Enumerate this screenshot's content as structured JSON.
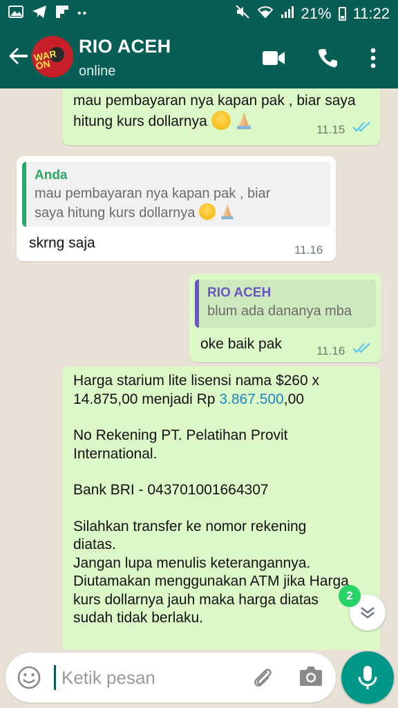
{
  "status_bar": {
    "battery": "21%",
    "time": "11:22"
  },
  "header": {
    "contact_name": "RIO ACEH",
    "status": "online",
    "avatar_text": "WAR ON"
  },
  "messages": [
    {
      "direction": "out",
      "lines": [
        "mau pembayaran nya kapan pak , biar saya",
        "hitung kurs dollarnya"
      ],
      "time": "11.15",
      "read": true
    },
    {
      "direction": "in",
      "quote_name": "Anda",
      "quote_lines": [
        "mau pembayaran nya kapan pak , biar",
        "saya hitung kurs dollarnya"
      ],
      "text": "skrng saja",
      "time": "11.16"
    },
    {
      "direction": "out",
      "quote_name": "RIO ACEH",
      "quote_text": "blum ada dananya mba",
      "text": "oke baik pak",
      "time": "11.16",
      "read": true
    },
    {
      "direction": "out",
      "line1": "Harga starium lite lisensi nama  $260 x",
      "line2_pre": "14.875,00  menjadi Rp ",
      "line2_link": "3.867.500",
      "line2_post": ",00",
      "line3": "No Rekening PT. Pelatihan Provit",
      "line4": "International.",
      "line5": "Bank BRI -  043701001664307",
      "line6": "Silahkan transfer ke nomor rekening",
      "line7": "diatas.",
      "line8": "Jangan lupa menulis keterangannya.",
      "line9": "Diutamakan menggunakan ATM jika Harga",
      "line10": "kurs dollarnya jauh maka harga diatas",
      "line11": "sudah tidak berlaku."
    }
  ],
  "unread_count": "2",
  "composer": {
    "placeholder": "Ketik pesan"
  },
  "colors": {
    "header": "#075e54",
    "outgoing": "#dcf8c6",
    "incoming": "#ffffff",
    "read_ticks": "#4fc3f7",
    "fab": "#009688"
  }
}
